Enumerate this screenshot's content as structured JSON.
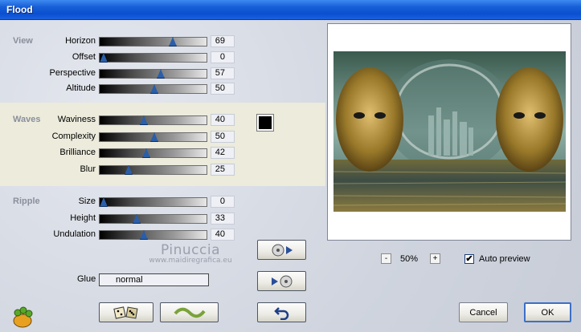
{
  "window": {
    "title": "Flood"
  },
  "sections": {
    "view": "View",
    "waves": "Waves",
    "ripple": "Ripple"
  },
  "params": [
    {
      "label": "Horizon",
      "value": "69",
      "level": 0.69
    },
    {
      "label": "Offset",
      "value": "0",
      "level": 0.0
    },
    {
      "label": "Perspective",
      "value": "57",
      "level": 0.57
    },
    {
      "label": "Altitude",
      "value": "50",
      "level": 0.5
    },
    {
      "label": "Waviness",
      "value": "40",
      "level": 0.4
    },
    {
      "label": "Complexity",
      "value": "50",
      "level": 0.5
    },
    {
      "label": "Brilliance",
      "value": "42",
      "level": 0.42
    },
    {
      "label": "Blur",
      "value": "25",
      "level": 0.25
    },
    {
      "label": "Size",
      "value": "0",
      "level": 0.0
    },
    {
      "label": "Height",
      "value": "33",
      "level": 0.33
    },
    {
      "label": "Undulation",
      "value": "40",
      "level": 0.4
    }
  ],
  "waves_color": "#000000",
  "glue": {
    "label": "Glue",
    "value": "normal"
  },
  "watermark": {
    "line1": "Pinuccia",
    "line2": "www.maidiregrafica.eu"
  },
  "zoom": {
    "minus": "-",
    "value": "50%",
    "plus": "+"
  },
  "auto_preview": {
    "label": "Auto preview",
    "checked": true,
    "mark": "✔"
  },
  "buttons": {
    "cancel": "Cancel",
    "ok": "OK"
  },
  "icons": {
    "app": "plugin-logo-icon",
    "random": "dice-icon",
    "wave": "wave-icon",
    "preset_save": "disc-forward-icon",
    "preset_load": "disc-back-icon",
    "undo": "undo-arrow-icon"
  }
}
